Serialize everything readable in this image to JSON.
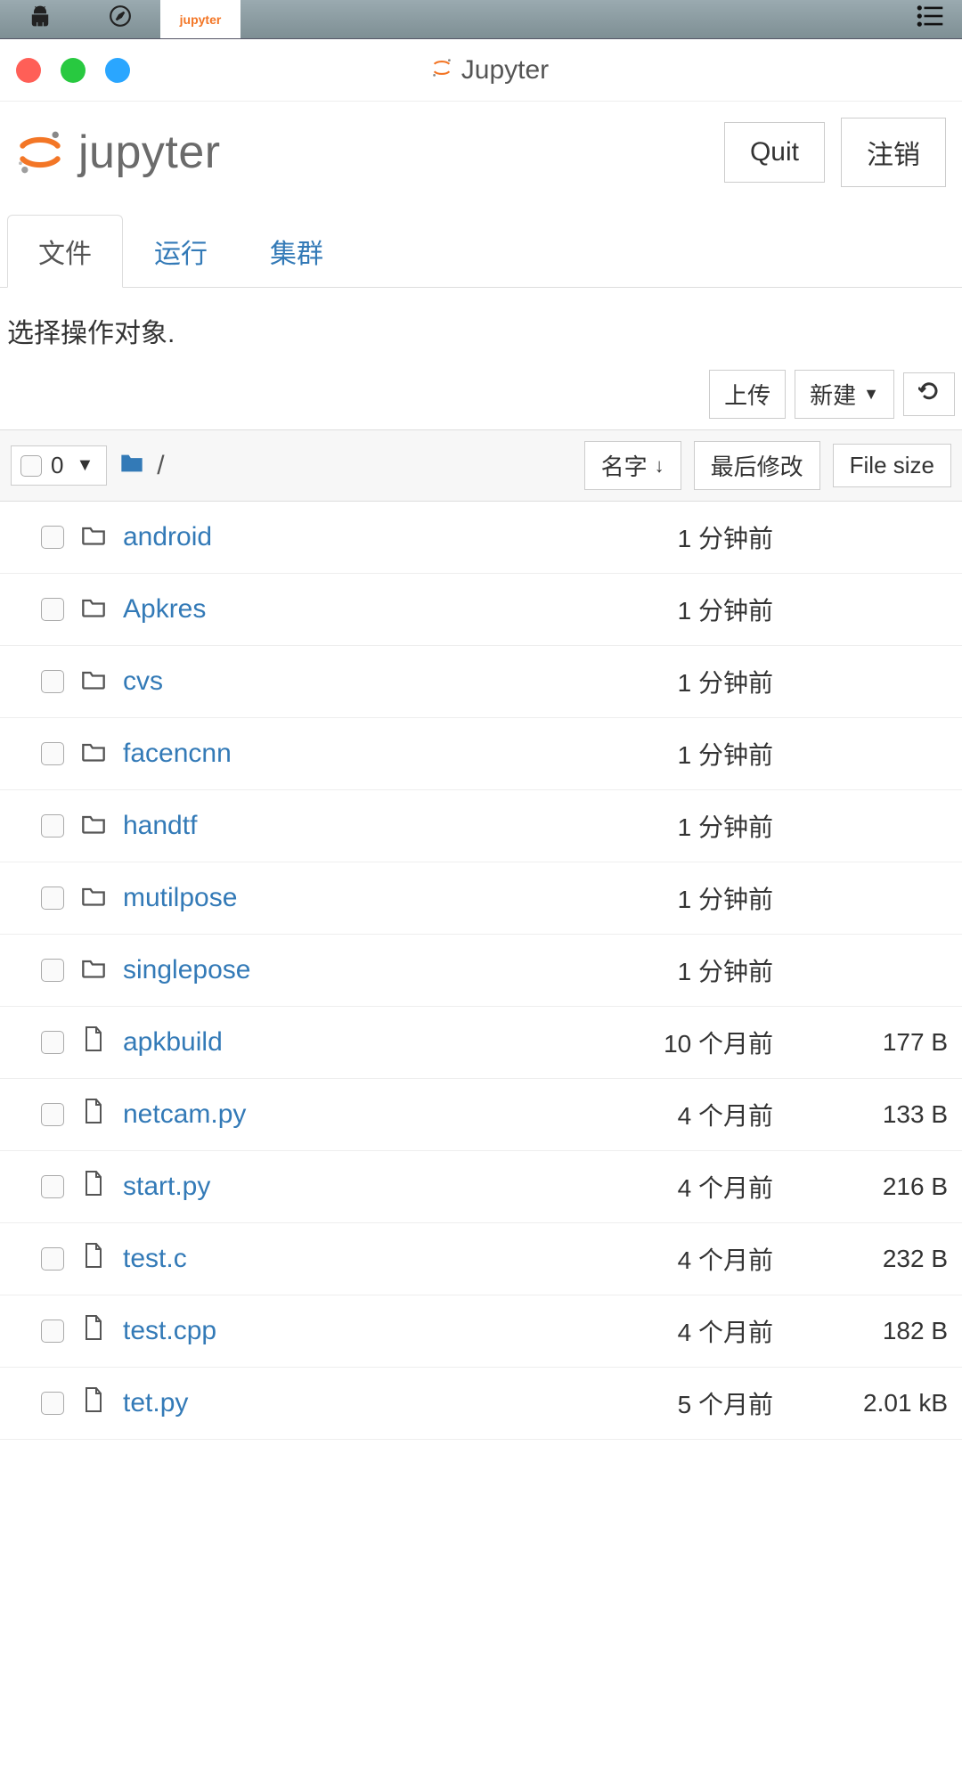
{
  "window": {
    "title": "Jupyter"
  },
  "header": {
    "logo_text": "jupyter",
    "quit_label": "Quit",
    "logout_label": "注销"
  },
  "tabs": {
    "files": "文件",
    "running": "运行",
    "clusters": "集群"
  },
  "instruction": "选择操作对象.",
  "actions": {
    "upload": "上传",
    "new": "新建"
  },
  "list_header": {
    "selected_count": "0",
    "breadcrumb_sep": "/",
    "sort_name": "名字",
    "sort_modified": "最后修改",
    "sort_size": "File size"
  },
  "files": [
    {
      "type": "folder",
      "name": "android",
      "modified": "1 分钟前",
      "size": ""
    },
    {
      "type": "folder",
      "name": "Apkres",
      "modified": "1 分钟前",
      "size": ""
    },
    {
      "type": "folder",
      "name": "cvs",
      "modified": "1 分钟前",
      "size": ""
    },
    {
      "type": "folder",
      "name": "facencnn",
      "modified": "1 分钟前",
      "size": ""
    },
    {
      "type": "folder",
      "name": "handtf",
      "modified": "1 分钟前",
      "size": ""
    },
    {
      "type": "folder",
      "name": "mutilpose",
      "modified": "1 分钟前",
      "size": ""
    },
    {
      "type": "folder",
      "name": "singlepose",
      "modified": "1 分钟前",
      "size": ""
    },
    {
      "type": "file",
      "name": "apkbuild",
      "modified": "10 个月前",
      "size": "177 B"
    },
    {
      "type": "file",
      "name": "netcam.py",
      "modified": "4 个月前",
      "size": "133 B"
    },
    {
      "type": "file",
      "name": "start.py",
      "modified": "4 个月前",
      "size": "216 B"
    },
    {
      "type": "file",
      "name": "test.c",
      "modified": "4 个月前",
      "size": "232 B"
    },
    {
      "type": "file",
      "name": "test.cpp",
      "modified": "4 个月前",
      "size": "182 B"
    },
    {
      "type": "file",
      "name": "tet.py",
      "modified": "5 个月前",
      "size": "2.01 kB"
    }
  ]
}
